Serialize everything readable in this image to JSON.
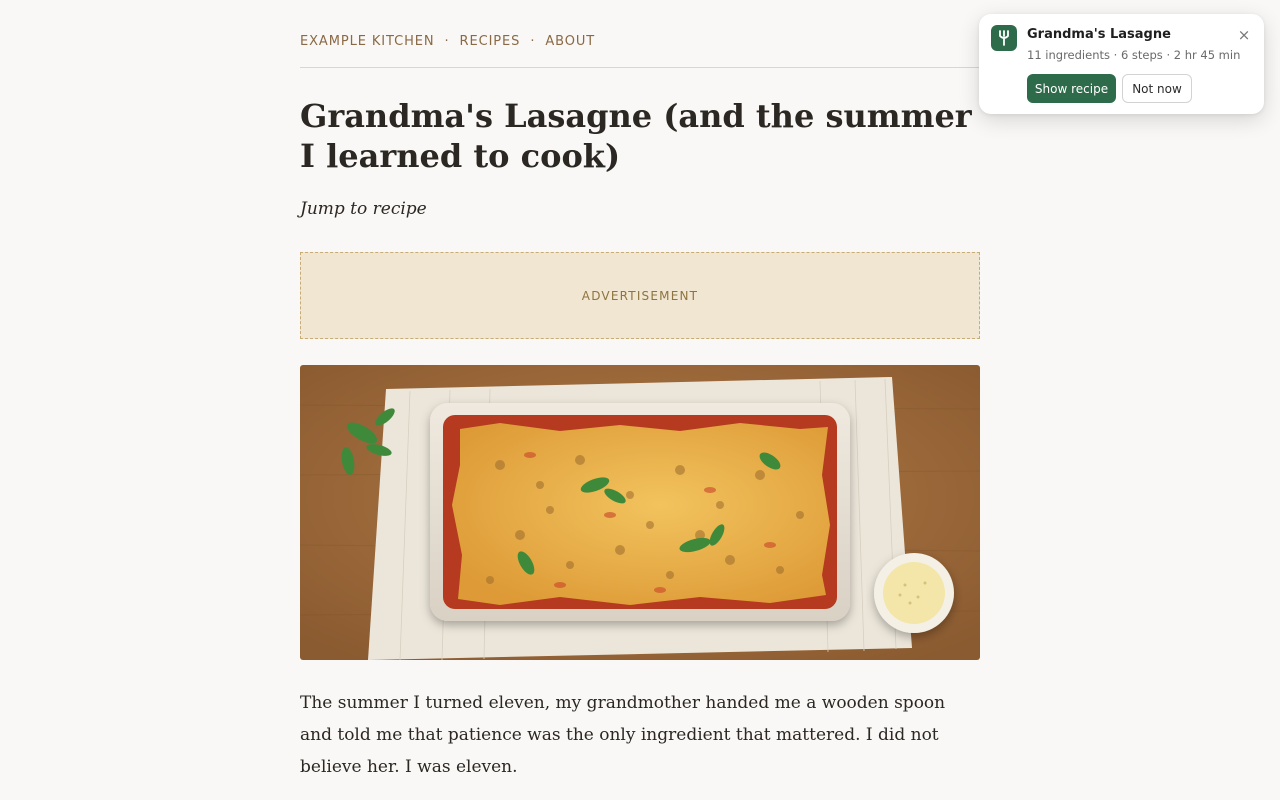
{
  "nav": {
    "items": [
      "EXAMPLE KITCHEN",
      "RECIPES",
      "ABOUT"
    ],
    "separator": "·"
  },
  "article": {
    "title": "Grandma's Lasagne (and the summer I learned to cook)",
    "jump_link": "Jump to recipe",
    "ad_label": "ADVERTISEMENT",
    "hero_image_subject": "lasagne-in-baking-dish",
    "paragraph_1": "The summer I turned eleven, my grandmother handed me a wooden spoon and told me that patience was the only ingredient that mattered. I did not believe her. I was eleven."
  },
  "toast": {
    "icon": "fork-icon",
    "title": "Grandma's Lasagne",
    "subtitle": "11 ingredients · 6 steps · 2 hr 45 min",
    "primary_button": "Show recipe",
    "secondary_button": "Not now",
    "close_glyph": "×"
  },
  "colors": {
    "background": "#faf8f6",
    "nav_accent": "#8a6a46",
    "ad_background": "#f1e6d1",
    "toast_brand": "#2e6b4a",
    "text": "#2b2723"
  }
}
